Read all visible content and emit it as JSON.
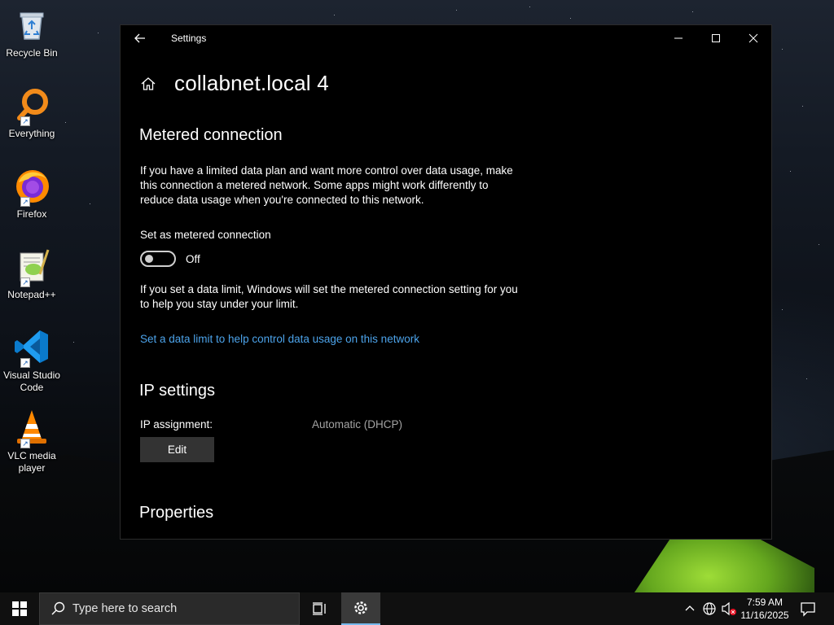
{
  "desktop": {
    "icons": [
      {
        "label": "Recycle Bin",
        "icon": "recycle-bin-icon"
      },
      {
        "label": "Everything",
        "icon": "everything-search-icon"
      },
      {
        "label": "Firefox",
        "icon": "firefox-icon"
      },
      {
        "label": "Notepad++",
        "icon": "notepad-plus-plus-icon"
      },
      {
        "label": "Visual Studio Code",
        "icon": "vscode-icon"
      },
      {
        "label": "VLC media player",
        "icon": "vlc-icon"
      }
    ]
  },
  "window": {
    "app_title": "Settings",
    "page_title": "collabnet.local 4",
    "metered": {
      "heading": "Metered connection",
      "description": "If you have a limited data plan and want more control over data usage, make this connection a metered network. Some apps might work differently to reduce data usage when you're connected to this network.",
      "toggle_label": "Set as metered connection",
      "toggle_state": "Off",
      "toggle_on": false,
      "data_limit_note": "If you set a data limit, Windows will set the metered connection setting for you to help you stay under your limit.",
      "data_limit_link": "Set a data limit to help control data usage on this network"
    },
    "ip": {
      "heading": "IP settings",
      "assignment_label": "IP assignment:",
      "assignment_value": "Automatic (DHCP)",
      "edit_label": "Edit"
    },
    "properties": {
      "heading": "Properties"
    }
  },
  "taskbar": {
    "search_placeholder": "Type here to search",
    "time": "7:59 AM",
    "date": "11/16/2025",
    "accent_color": "#76b9ed"
  },
  "colors": {
    "link": "#4ca3ea",
    "window_bg": "#000000",
    "secondary_text": "#a3a3a3"
  }
}
